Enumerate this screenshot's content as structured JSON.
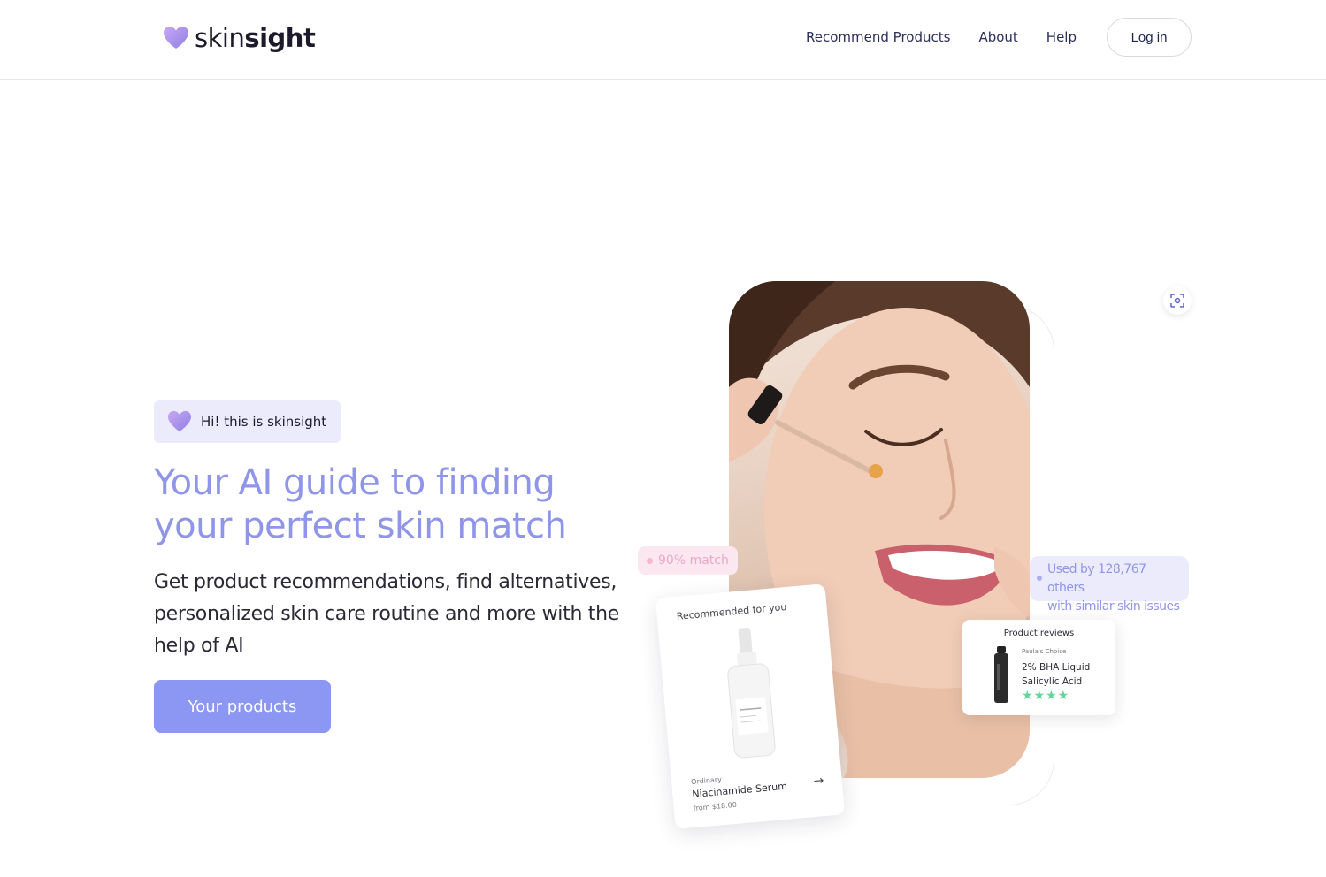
{
  "header": {
    "logo": {
      "prefix": "skin",
      "suffix": "sight",
      "icon": "heart-icon"
    },
    "nav": [
      {
        "label": "Recommend Products"
      },
      {
        "label": "About"
      },
      {
        "label": "Help"
      }
    ],
    "login_label": "Log in"
  },
  "hero": {
    "badge_text": "Hi! this is skinsight",
    "title_line1": "Your AI guide to finding",
    "title_line2": "your perfect skin match",
    "subtitle": "Get product recommendations, find alternatives, personalized skin care routine and more with the help of AI",
    "cta_label": "Your products"
  },
  "visual": {
    "match_label": "90% match",
    "used_line1": "Used by 128,767 others",
    "used_line2": "with similar skin issues",
    "recommended": {
      "title": "Recommended for you",
      "brand": "Ordinary",
      "product": "Niacinamide Serum",
      "price": "from $18.00"
    },
    "reviews": {
      "title": "Product reviews",
      "brand": "Paula's Choice",
      "product_line1": "2% BHA Liquid",
      "product_line2": "Salicylic Acid",
      "stars": "★★★★"
    }
  },
  "colors": {
    "accent": "#8f95e8",
    "button": "#8b97f2",
    "badge_bg": "#ecebfb",
    "match_bg": "#fbe7f0",
    "star": "#63d69a"
  }
}
